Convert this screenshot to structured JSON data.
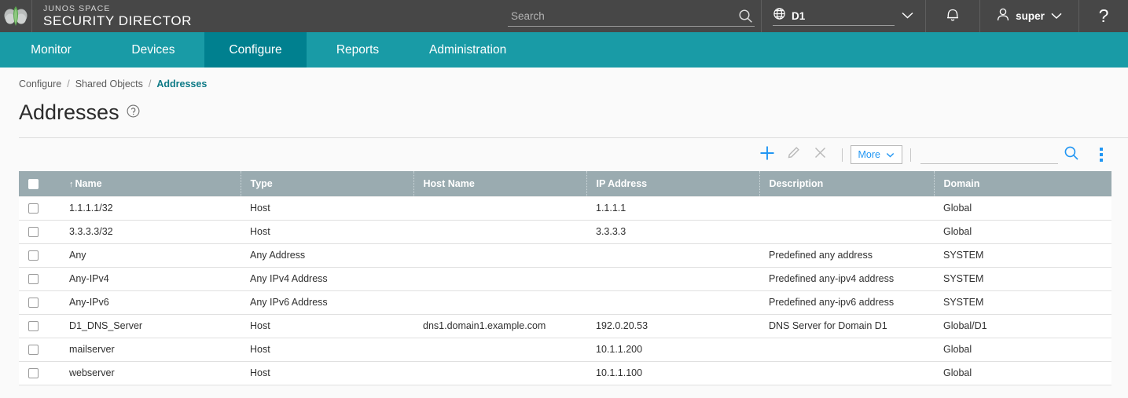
{
  "header": {
    "logo_icon": "juniper-logo-icon",
    "brand_line1": "JUNOS SPACE",
    "brand_line2": "SECURITY DIRECTOR",
    "search": {
      "value": "",
      "placeholder": "Search",
      "icon": "search-icon"
    },
    "domain": {
      "label": "D1",
      "icon": "globe-icon",
      "chevron": "chevron-down-icon"
    },
    "notifications_icon": "bell-icon",
    "user": {
      "label": "super",
      "icon": "user-icon",
      "chevron": "chevron-down-icon"
    },
    "help_label": "?"
  },
  "nav": {
    "items": [
      {
        "label": "Monitor",
        "active": false
      },
      {
        "label": "Devices",
        "active": false
      },
      {
        "label": "Configure",
        "active": true
      },
      {
        "label": "Reports",
        "active": false
      },
      {
        "label": "Administration",
        "active": false
      }
    ],
    "active_color": "#00808f",
    "bar_color": "#199ba6"
  },
  "breadcrumb": {
    "items": [
      "Configure",
      "Shared Objects",
      "Addresses"
    ],
    "separator": "/",
    "current_color": "#0e7a86"
  },
  "page": {
    "title": "Addresses",
    "help_icon": "help-circle-icon"
  },
  "toolbar": {
    "add_icon": "plus-icon",
    "edit_icon": "pencil-icon",
    "delete_icon": "close-x-icon",
    "more_label": "More",
    "more_chevron": "chevron-down-icon",
    "search": {
      "value": "",
      "placeholder": "",
      "icon": "search-icon"
    },
    "overflow_icon": "vertical-dots-icon",
    "accent_color": "#2196f3"
  },
  "table": {
    "header_bg": "#9aabb0",
    "sort_column": "Name",
    "sort_direction": "ascending",
    "sort_arrow": "↑",
    "columns": [
      {
        "key": "checkbox",
        "label": ""
      },
      {
        "key": "name",
        "label": "Name"
      },
      {
        "key": "type",
        "label": "Type"
      },
      {
        "key": "host_name",
        "label": "Host Name"
      },
      {
        "key": "ip_address",
        "label": "IP Address"
      },
      {
        "key": "description",
        "label": "Description"
      },
      {
        "key": "domain",
        "label": "Domain"
      }
    ],
    "rows": [
      {
        "name": "1.1.1.1/32",
        "type": "Host",
        "host_name": "",
        "ip_address": "1.1.1.1",
        "description": "",
        "domain": "Global"
      },
      {
        "name": "3.3.3.3/32",
        "type": "Host",
        "host_name": "",
        "ip_address": "3.3.3.3",
        "description": "",
        "domain": "Global"
      },
      {
        "name": "Any",
        "type": "Any Address",
        "host_name": "",
        "ip_address": "",
        "description": "Predefined any address",
        "domain": "SYSTEM"
      },
      {
        "name": "Any-IPv4",
        "type": "Any IPv4 Address",
        "host_name": "",
        "ip_address": "",
        "description": "Predefined any-ipv4 address",
        "domain": "SYSTEM"
      },
      {
        "name": "Any-IPv6",
        "type": "Any IPv6 Address",
        "host_name": "",
        "ip_address": "",
        "description": "Predefined any-ipv6 address",
        "domain": "SYSTEM"
      },
      {
        "name": "D1_DNS_Server",
        "type": "Host",
        "host_name": "dns1.domain1.example.com",
        "ip_address": "192.0.20.53",
        "description": "DNS Server for Domain D1",
        "domain": "Global/D1"
      },
      {
        "name": "mailserver",
        "type": "Host",
        "host_name": "",
        "ip_address": "10.1.1.200",
        "description": "",
        "domain": "Global"
      },
      {
        "name": "webserver",
        "type": "Host",
        "host_name": "",
        "ip_address": "10.1.1.100",
        "description": "",
        "domain": "Global"
      }
    ]
  }
}
